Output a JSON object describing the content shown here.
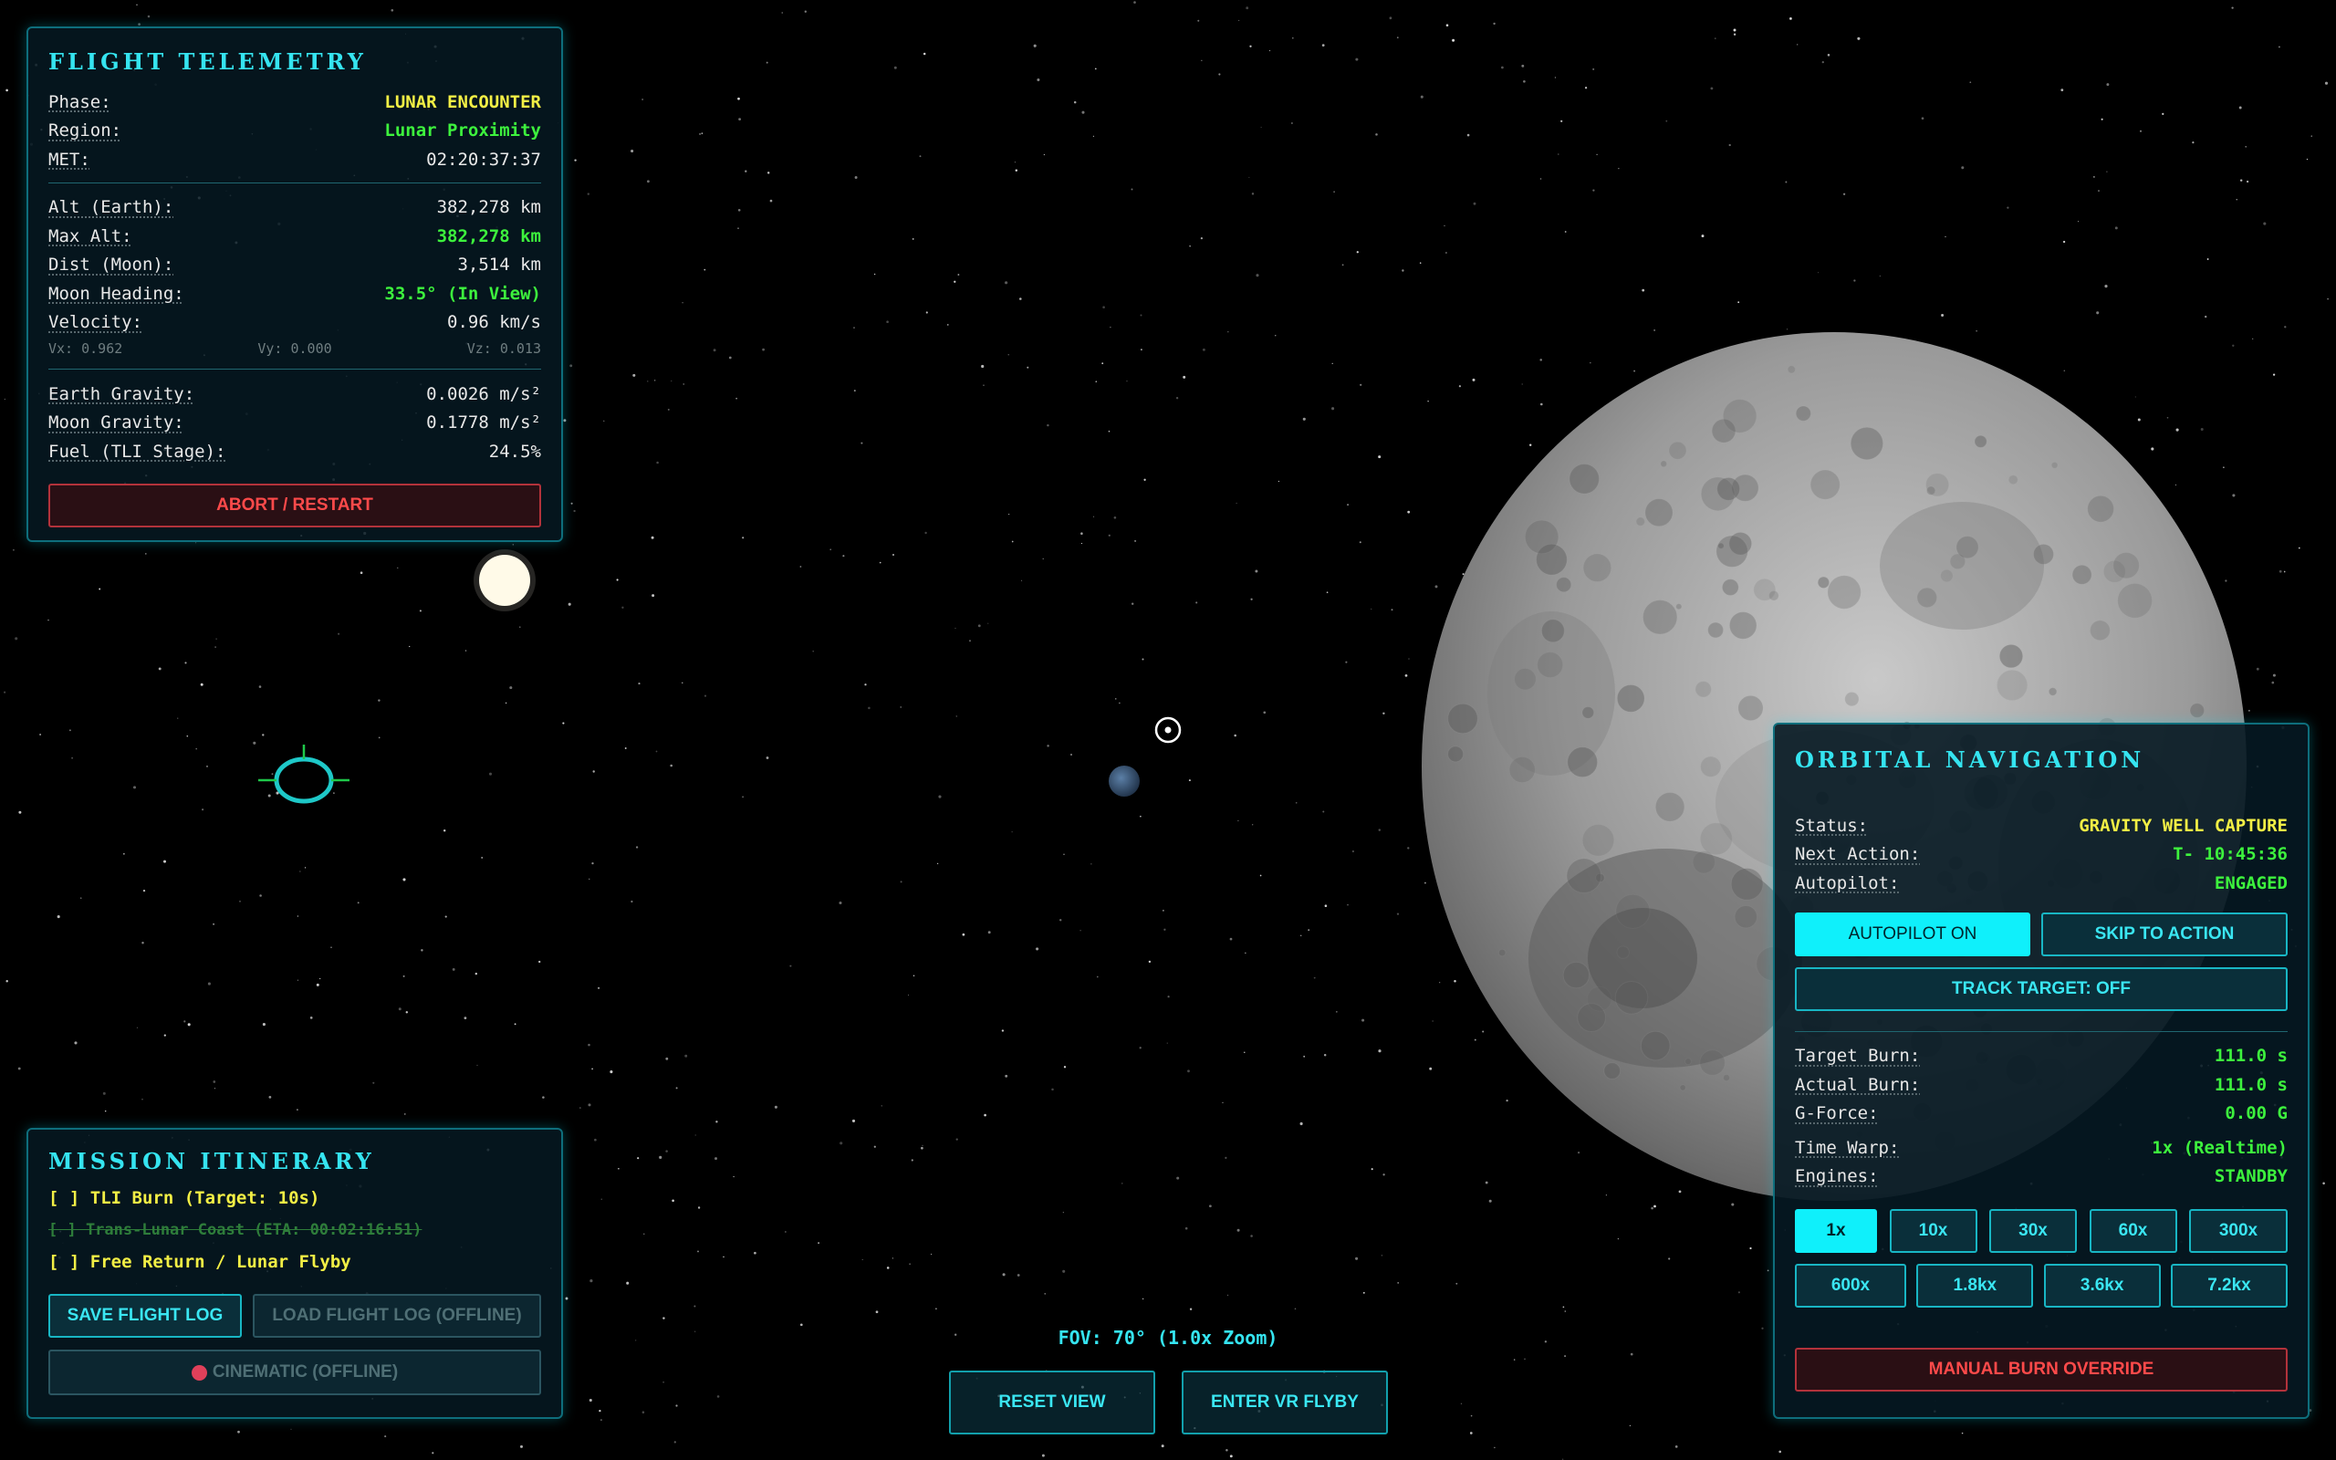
{
  "telemetry": {
    "title": "FLIGHT TELEMETRY",
    "phase_label": "Phase:",
    "phase_value": "LUNAR ENCOUNTER",
    "region_label": "Region:",
    "region_value": "Lunar Proximity",
    "met_label": "MET:",
    "met_value": "02:20:37:37",
    "alt_label": "Alt (Earth):",
    "alt_value": "382,278 km",
    "maxalt_label": "Max Alt:",
    "maxalt_value": "382,278 km",
    "distmoon_label": "Dist (Moon):",
    "distmoon_value": "3,514 km",
    "heading_label": "Moon Heading:",
    "heading_value": "33.5° (In View)",
    "velocity_label": "Velocity:",
    "velocity_value": "0.96 km/s",
    "vx": "Vx: 0.962",
    "vy": "Vy: 0.000",
    "vz": "Vz: 0.013",
    "egrav_label": "Earth Gravity:",
    "egrav_value": "0.0026 m/s²",
    "mgrav_label": "Moon Gravity:",
    "mgrav_value": "0.1778 m/s²",
    "fuel_label": "Fuel (TLI Stage):",
    "fuel_value": "24.5%",
    "abort_button": "ABORT / RESTART"
  },
  "itinerary": {
    "title": "MISSION ITINERARY",
    "items": [
      {
        "text": "[ ] TLI Burn (Target: 10s)",
        "state": "active"
      },
      {
        "text": "[ ] Trans-Lunar Coast (ETA: 00:02:16:51)",
        "state": "skipped"
      },
      {
        "text": "[ ] Free Return / Lunar Flyby",
        "state": "active"
      }
    ],
    "save_button": "SAVE FLIGHT LOG",
    "load_button": "LOAD FLIGHT LOG (OFFLINE)",
    "cinematic_button": "CINEMATIC (OFFLINE)"
  },
  "navigation": {
    "title": "ORBITAL NAVIGATION",
    "status_label": "Status:",
    "status_value": "GRAVITY WELL CAPTURE",
    "next_label": "Next Action:",
    "next_value": "T- 10:45:36",
    "autopilot_label": "Autopilot:",
    "autopilot_value": "ENGAGED",
    "autopilot_button": "AUTOPILOT ON",
    "skip_button": "SKIP TO ACTION",
    "track_button": "TRACK TARGET: OFF",
    "tburn_label": "Target Burn:",
    "tburn_value": "111.0 s",
    "aburn_label": "Actual Burn:",
    "aburn_value": "111.0 s",
    "gforce_label": "G-Force:",
    "gforce_value": "0.00 G",
    "warp_label": "Time Warp:",
    "warp_value": "1x (Realtime)",
    "engines_label": "Engines:",
    "engines_value": "STANDBY",
    "warp_row1": [
      "1x",
      "10x",
      "30x",
      "60x",
      "300x"
    ],
    "warp_row2": [
      "600x",
      "1.8kx",
      "3.6kx",
      "7.2kx"
    ],
    "selected_warp": "1x",
    "manual_button": "MANUAL BURN OVERRIDE"
  },
  "view": {
    "fov": "FOV: 70° (1.0x Zoom)",
    "reset_button": "RESET VIEW",
    "vr_button": "ENTER VR FLYBY"
  },
  "colors": {
    "accent": "#35e4f0",
    "warning": "#f3ef45",
    "ok": "#3df23d",
    "danger": "#ff4a4a"
  }
}
